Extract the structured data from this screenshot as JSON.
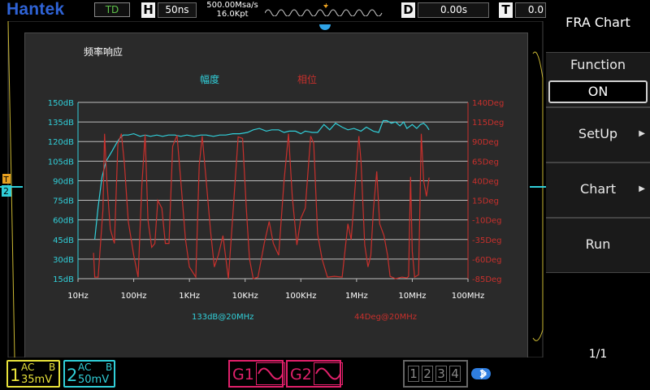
{
  "topbar": {
    "brand": "Hantek",
    "mode": "TD",
    "horizontal_key": "H",
    "timebase": "50ns",
    "sample_rate": "500.00Msa/s",
    "memory_depth": "16.0Kpt",
    "trigger_marker": "T",
    "delay_key": "D",
    "delay_value": "0.00s",
    "trigger_key": "T",
    "trigger_value": "0.0"
  },
  "scope": {
    "trigger_level_marker": "T",
    "channel_marker": "2"
  },
  "fra_chart": {
    "title": "频率响应",
    "legend_amplitude": "幅度",
    "legend_phase": "相位",
    "readout_amplitude": "133dB@20MHz",
    "readout_phase": "44Deg@20MHz"
  },
  "chart_data": {
    "type": "line",
    "x_scale": "log",
    "x_tick_labels": [
      "10Hz",
      "100Hz",
      "1KHz",
      "10KHz",
      "100KHz",
      "1MHz",
      "10MHz",
      "100MHz"
    ],
    "y_left_tick_labels": [
      "150dB",
      "135dB",
      "120dB",
      "105dB",
      "90dB",
      "75dB",
      "60dB",
      "45dB",
      "30dB",
      "15dB"
    ],
    "y_right_tick_labels": [
      "140Deg",
      "115Deg",
      "90Deg",
      "65Deg",
      "40Deg",
      "15Deg",
      "-10Deg",
      "-35Deg",
      "-60Deg",
      "-85Deg"
    ],
    "ylim_left": [
      15,
      150
    ],
    "ylim_right": [
      -85,
      140
    ],
    "grid": true,
    "colors": {
      "amplitude": "#31cfd9",
      "phase": "#c8302c",
      "left_axis": "#31cfd9",
      "right_axis": "#c8302c"
    },
    "series": [
      {
        "name": "幅度",
        "axis": "left",
        "points": [
          [
            20,
            45
          ],
          [
            23,
            70
          ],
          [
            27,
            93
          ],
          [
            32,
            105
          ],
          [
            40,
            112
          ],
          [
            48,
            118
          ],
          [
            55,
            122
          ],
          [
            65,
            125
          ],
          [
            80,
            125
          ],
          [
            100,
            126
          ],
          [
            130,
            124
          ],
          [
            160,
            125
          ],
          [
            200,
            124
          ],
          [
            260,
            125
          ],
          [
            330,
            124
          ],
          [
            420,
            125
          ],
          [
            550,
            125
          ],
          [
            700,
            124
          ],
          [
            900,
            125
          ],
          [
            1200,
            124
          ],
          [
            1600,
            125
          ],
          [
            2000,
            125
          ],
          [
            2700,
            124
          ],
          [
            3500,
            125
          ],
          [
            4500,
            125
          ],
          [
            6000,
            126
          ],
          [
            8000,
            126
          ],
          [
            11000,
            127
          ],
          [
            14000,
            129
          ],
          [
            18000,
            130
          ],
          [
            24000,
            128
          ],
          [
            30000,
            129
          ],
          [
            40000,
            129
          ],
          [
            50000,
            127
          ],
          [
            62000,
            128
          ],
          [
            80000,
            128
          ],
          [
            100000,
            126
          ],
          [
            120000,
            128
          ],
          [
            160000,
            127
          ],
          [
            200000,
            127
          ],
          [
            260000,
            133
          ],
          [
            330000,
            129
          ],
          [
            420000,
            134
          ],
          [
            550000,
            131
          ],
          [
            700000,
            129
          ],
          [
            900000,
            130
          ],
          [
            1200000,
            128
          ],
          [
            1500000,
            131
          ],
          [
            2000000,
            128
          ],
          [
            2500000,
            127
          ],
          [
            3000000,
            136
          ],
          [
            3500000,
            136
          ],
          [
            4200000,
            134
          ],
          [
            5000000,
            135
          ],
          [
            6000000,
            132
          ],
          [
            7000000,
            135
          ],
          [
            8000000,
            130
          ],
          [
            10000000,
            133
          ],
          [
            12000000,
            130
          ],
          [
            14000000,
            133
          ],
          [
            16000000,
            134
          ],
          [
            18000000,
            132
          ],
          [
            20000000,
            129
          ]
        ]
      },
      {
        "name": "相位",
        "axis": "right",
        "points": [
          [
            19,
            -52
          ],
          [
            20,
            -83
          ],
          [
            23,
            -83
          ],
          [
            28,
            3
          ],
          [
            30,
            100
          ],
          [
            33,
            38
          ],
          [
            38,
            -22
          ],
          [
            45,
            -40
          ],
          [
            52,
            87
          ],
          [
            60,
            100
          ],
          [
            68,
            62
          ],
          [
            80,
            -12
          ],
          [
            100,
            -55
          ],
          [
            120,
            -83
          ],
          [
            140,
            34
          ],
          [
            160,
            99
          ],
          [
            180,
            -10
          ],
          [
            210,
            -45
          ],
          [
            240,
            -40
          ],
          [
            270,
            15
          ],
          [
            320,
            5
          ],
          [
            370,
            -40
          ],
          [
            430,
            -40
          ],
          [
            500,
            84
          ],
          [
            600,
            98
          ],
          [
            700,
            40
          ],
          [
            850,
            -35
          ],
          [
            1000,
            -70
          ],
          [
            1300,
            -83
          ],
          [
            1500,
            60
          ],
          [
            1700,
            97
          ],
          [
            2000,
            40
          ],
          [
            2400,
            -25
          ],
          [
            2800,
            -70
          ],
          [
            3300,
            -55
          ],
          [
            4000,
            -30
          ],
          [
            5000,
            -85
          ],
          [
            6000,
            -5
          ],
          [
            7500,
            96
          ],
          [
            9000,
            94
          ],
          [
            10500,
            4
          ],
          [
            12000,
            -60
          ],
          [
            14000,
            -85
          ],
          [
            17000,
            -83
          ],
          [
            22000,
            -40
          ],
          [
            27000,
            -12
          ],
          [
            32000,
            -40
          ],
          [
            40000,
            -55
          ],
          [
            50000,
            40
          ],
          [
            60000,
            100
          ],
          [
            70000,
            20
          ],
          [
            85000,
            -42
          ],
          [
            100000,
            -8
          ],
          [
            120000,
            5
          ],
          [
            150000,
            97
          ],
          [
            170000,
            88
          ],
          [
            200000,
            -28
          ],
          [
            240000,
            -60
          ],
          [
            300000,
            -83
          ],
          [
            400000,
            -82
          ],
          [
            550000,
            -83
          ],
          [
            700000,
            -15
          ],
          [
            800000,
            -35
          ],
          [
            950000,
            35
          ],
          [
            1100000,
            97
          ],
          [
            1200000,
            65
          ],
          [
            1400000,
            -42
          ],
          [
            1600000,
            -70
          ],
          [
            1800000,
            -55
          ],
          [
            2000000,
            2
          ],
          [
            2300000,
            52
          ],
          [
            2600000,
            -15
          ],
          [
            3100000,
            -30
          ],
          [
            3600000,
            -55
          ],
          [
            4000000,
            -82
          ],
          [
            5000000,
            -85
          ],
          [
            6500000,
            -83
          ],
          [
            8000000,
            -84
          ],
          [
            8600000,
            -82
          ],
          [
            9300000,
            45
          ],
          [
            10000000,
            -50
          ],
          [
            11000000,
            -83
          ],
          [
            13000000,
            -80
          ],
          [
            14500000,
            100
          ],
          [
            16000000,
            40
          ],
          [
            18000000,
            20
          ],
          [
            20000000,
            44
          ]
        ]
      }
    ]
  },
  "menu": {
    "title": "FRA Chart",
    "function_label": "Function",
    "function_value": "ON",
    "setup_label": "SetUp",
    "chart_label": "Chart",
    "run_label": "Run",
    "page": "1/1"
  },
  "bottombar": {
    "ch1": {
      "number": "1",
      "coupling": "AC",
      "bw": "B",
      "scale": "35mV",
      "color": "#e8e23a"
    },
    "ch2": {
      "number": "2",
      "coupling": "AC",
      "bw": "B",
      "scale": "50mV",
      "color": "#31cfd9"
    },
    "g1": "G1",
    "g2": "G2",
    "channel_buttons": [
      "1",
      "2",
      "3",
      "4"
    ],
    "bluetooth_icon": "bluetooth-icon"
  }
}
